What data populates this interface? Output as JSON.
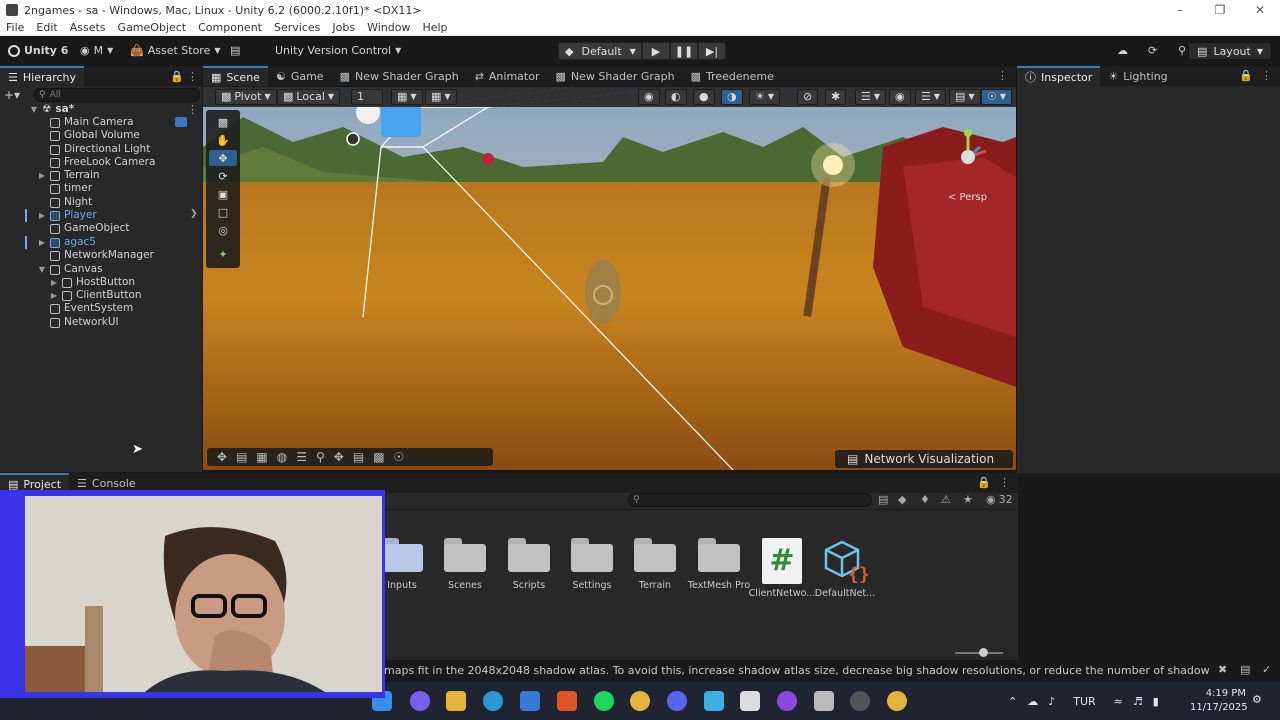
{
  "window": {
    "title": "2ngames - sa - Windows, Mac, Linux - Unity 6.2 (6000.2.10f1)* <DX11>"
  },
  "menu": [
    "File",
    "Edit",
    "Assets",
    "GameObject",
    "Component",
    "Services",
    "Jobs",
    "Window",
    "Help"
  ],
  "toolbar": {
    "unity_label": "Unity 6",
    "account_label": "M",
    "asset_store": "Asset Store",
    "version_control": "Unity Version Control",
    "build_profile": "Default",
    "layout": "Layout"
  },
  "hierarchy": {
    "tab": "Hierarchy",
    "search_placeholder": "All",
    "scene_name": "sa*",
    "items": [
      {
        "label": "Main Camera"
      },
      {
        "label": "Global Volume"
      },
      {
        "label": "Directional Light"
      },
      {
        "label": "FreeLook Camera"
      },
      {
        "label": "Terrain"
      },
      {
        "label": "timer"
      },
      {
        "label": "Night"
      },
      {
        "label": "Player"
      },
      {
        "label": "GameObject"
      },
      {
        "label": "agac5"
      },
      {
        "label": "NetworkManager"
      },
      {
        "label": "Canvas"
      },
      {
        "label": "HostButton"
      },
      {
        "label": "ClientButton"
      },
      {
        "label": "EventSystem"
      },
      {
        "label": "NetworkUI"
      }
    ]
  },
  "center_tabs": [
    "Scene",
    "Game",
    "New Shader Graph",
    "Animator",
    "New Shader Graph",
    "Treedeneme"
  ],
  "scene_toolbar": {
    "pivot": "Pivot",
    "local": "Local",
    "snap_value": "1"
  },
  "scene": {
    "persp_label": "< Persp",
    "network_visualization": "Network Visualization"
  },
  "right_tabs": [
    "Inspector",
    "Lighting"
  ],
  "bottom_tabs": [
    "Project",
    "Console"
  ],
  "project": {
    "item_count": "32",
    "items": [
      {
        "label": "Inputs",
        "kind": "folder"
      },
      {
        "label": "Scenes",
        "kind": "folder"
      },
      {
        "label": "Scripts",
        "kind": "folder"
      },
      {
        "label": "Settings",
        "kind": "folder"
      },
      {
        "label": "Terrain",
        "kind": "folder"
      },
      {
        "label": "TextMesh Pro",
        "kind": "folder"
      },
      {
        "label": "ClientNetwo...",
        "kind": "script"
      },
      {
        "label": "DefaultNet...",
        "kind": "asset"
      }
    ]
  },
  "status": {
    "message": "maps fit in the 2048x2048 shadow atlas. To avoid this, increase shadow atlas size, decrease big shadow resolutions, or reduce the number of shadow maps active in the"
  },
  "taskbar": {
    "language": "TUR",
    "time": "4:19 PM",
    "date": "11/17/2025"
  },
  "colors": {
    "accent": "#3a79bb",
    "hierarchy_blue": "#6fa8ee",
    "webcam_frame": "#3b33e8"
  }
}
